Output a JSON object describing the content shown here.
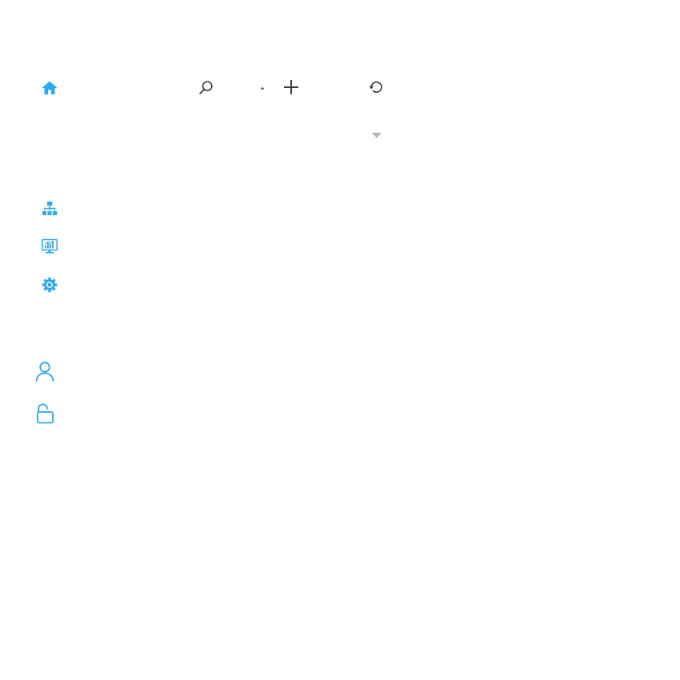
{
  "colors": {
    "accent": "#2aa8f2",
    "toolbar_icon": "#3a3a3a",
    "caret": "#b3b3b3"
  },
  "sidebar": {
    "top_icons": [
      {
        "icon": "home-icon"
      }
    ],
    "nav_icons": [
      {
        "icon": "network-topology-icon"
      },
      {
        "icon": "monitor-chart-icon"
      },
      {
        "icon": "gear-icon"
      }
    ],
    "account_icons": [
      {
        "icon": "user-icon"
      },
      {
        "icon": "unlock-icon"
      }
    ]
  },
  "toolbar": {
    "icons": [
      {
        "icon": "search-icon"
      },
      {
        "icon": "caret-up-icon"
      },
      {
        "icon": "plus-icon"
      },
      {
        "icon": "refresh-icon"
      }
    ],
    "dropdown": {
      "icon": "caret-down-icon"
    }
  }
}
